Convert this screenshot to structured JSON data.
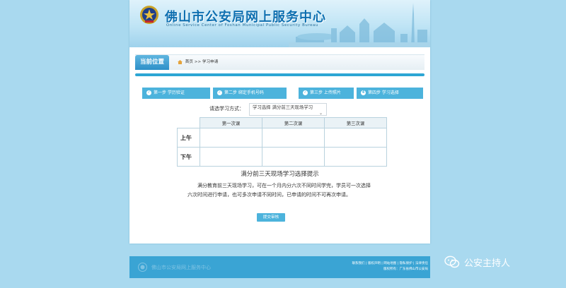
{
  "header": {
    "title": "佛山市公安局网上服务中心",
    "subtitle": "Online Service Center of Foshan Municipal Public Security Bureau"
  },
  "breadcrumb": {
    "label": "当前位置",
    "home": "首页",
    "separator": ">>",
    "current": "学习申请"
  },
  "steps": [
    {
      "num": "✓",
      "label": "第一步 学历验证"
    },
    {
      "num": "✓",
      "label": "第二步 绑定手机号码"
    },
    {
      "num": "✓",
      "label": "第三步 上传照片"
    },
    {
      "num": "4",
      "label": "第四步 学习选择"
    }
  ],
  "form": {
    "label": "请选学习方式：",
    "selected": "学习选择 满分前三天现场学习"
  },
  "schedule": {
    "columns": [
      "",
      "第一次课",
      "第二次课",
      "第三次课"
    ],
    "rows": [
      "上午",
      "下午"
    ]
  },
  "notice": {
    "title": "满分前三天现场学习选择提示",
    "body": "满分教育前三天现场学习，可在一个月内分六次不同时间学完，学员可一次选择六次时间进行申请，也可多次申请不同时间，已申请的时间不可再次申请。"
  },
  "submit_label": "提交审核",
  "footer": {
    "name": "佛山市公安局网上服务中心",
    "links": [
      "联系我们",
      "版权声明",
      "网站地图",
      "隐私保护",
      "法律责任"
    ],
    "copyright": "版权所有：广东省佛山市公安局"
  },
  "watermark": "公安主持人",
  "colors": {
    "accent": "#4cb3dc",
    "page_bg": "#a9d9ef",
    "footer": "#3aa4d4"
  }
}
